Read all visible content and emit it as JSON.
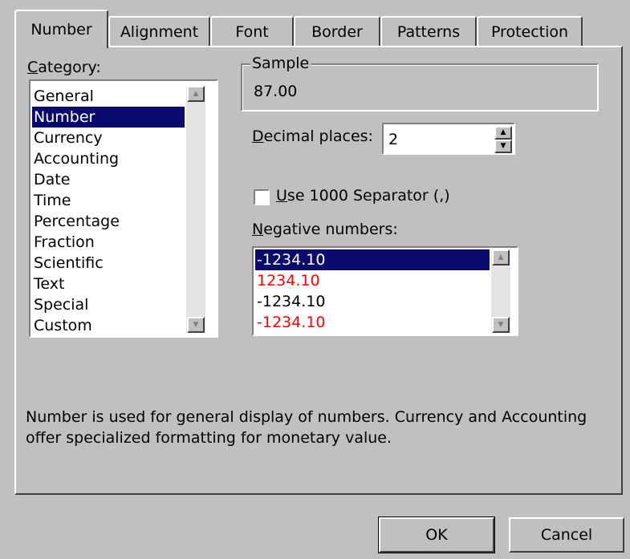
{
  "tabs": [
    {
      "label": "Number",
      "active": true
    },
    {
      "label": "Alignment"
    },
    {
      "label": "Font"
    },
    {
      "label": "Border"
    },
    {
      "label": "Patterns"
    },
    {
      "label": "Protection"
    }
  ],
  "category": {
    "label_mnemonic": "C",
    "label_rest": "ategory:",
    "items": [
      "General",
      "Number",
      "Currency",
      "Accounting",
      "Date",
      "Time",
      "Percentage",
      "Fraction",
      "Scientific",
      "Text",
      "Special",
      "Custom"
    ],
    "selected": "Number"
  },
  "sample": {
    "legend": "Sample",
    "value": "87.00"
  },
  "decimal_places": {
    "label_mnemonic": "D",
    "label_rest": "ecimal places:",
    "value": "2"
  },
  "separator": {
    "label_mnemonic": "U",
    "label_rest": "se 1000 Separator (,)",
    "checked": false
  },
  "negative_numbers": {
    "label_mnemonic": "N",
    "label_rest": "egative numbers:",
    "items": [
      {
        "text": "-1234.10",
        "color": "#000000",
        "selected": true
      },
      {
        "text": "1234.10",
        "color": "#ff0000"
      },
      {
        "text": "-1234.10",
        "color": "#000000"
      },
      {
        "text": "-1234.10",
        "color": "#ff0000"
      }
    ]
  },
  "description": {
    "line1": "Number is used for general display of numbers.  Currency and Accounting",
    "line2": "offer specialized formatting for monetary value."
  },
  "buttons": {
    "ok": "OK",
    "cancel": "Cancel"
  },
  "colors": {
    "selection": "#0a0a6e",
    "face": "#c0c0c0",
    "red": "#ff0000"
  }
}
